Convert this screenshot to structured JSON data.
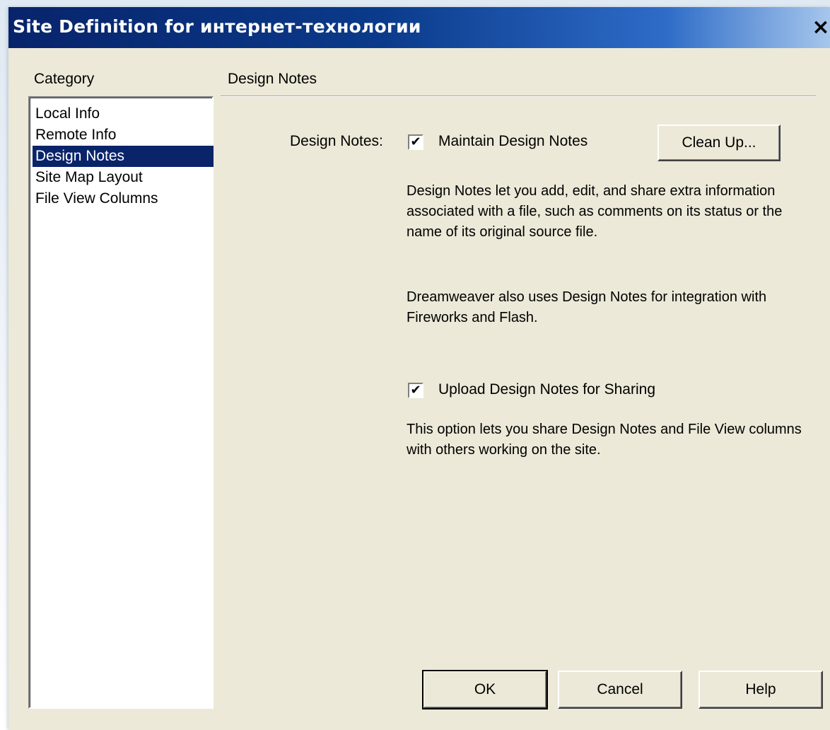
{
  "window": {
    "title": "Site Definition for интернет-технологии",
    "close_glyph": "×"
  },
  "category": {
    "label": "Category",
    "items": [
      {
        "label": "Local Info"
      },
      {
        "label": "Remote Info"
      },
      {
        "label": "Design Notes",
        "selected": true
      },
      {
        "label": "Site Map Layout"
      },
      {
        "label": "File View Columns"
      }
    ]
  },
  "panel": {
    "title": "Design Notes",
    "design_notes_label": "Design Notes:",
    "maintain": {
      "label": "Maintain Design Notes",
      "checked": true
    },
    "cleanup_button": "Clean Up...",
    "description_1": "Design Notes let you add, edit, and share extra information associated with a file, such as comments on its status or the name of its original source file.",
    "description_2": "Dreamweaver also uses Design Notes for integration with Fireworks and Flash.",
    "upload": {
      "label": "Upload Design Notes for Sharing",
      "checked": true
    },
    "description_3": "This option lets you share Design Notes and File View columns with others working on the site."
  },
  "buttons": {
    "ok": "OK",
    "cancel": "Cancel",
    "help": "Help"
  },
  "check_glyph": "✔"
}
